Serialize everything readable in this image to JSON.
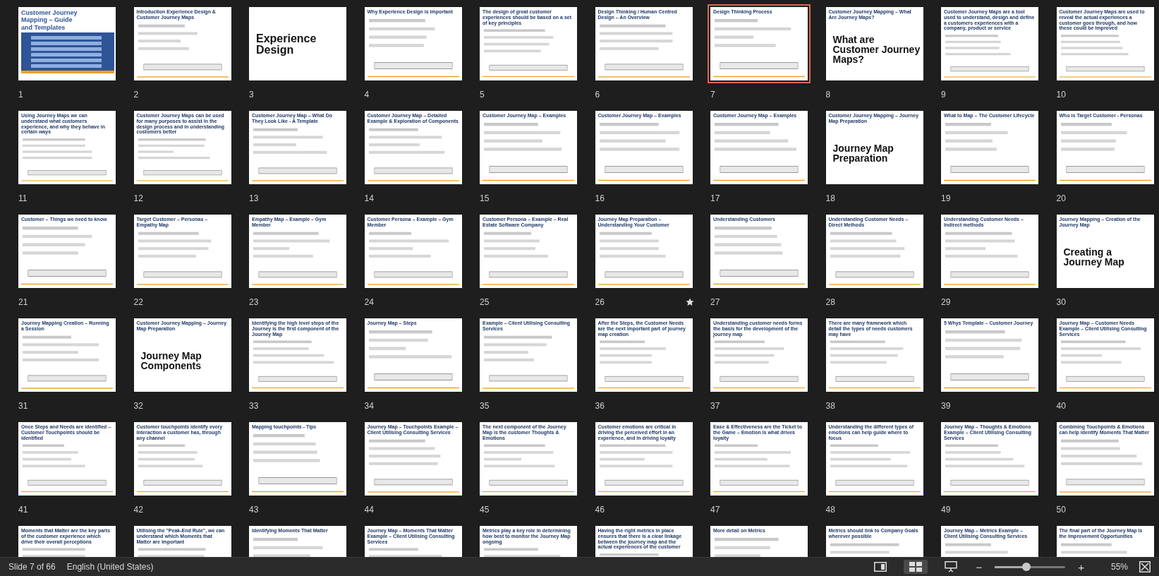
{
  "slides": [
    {
      "number": "1",
      "kind": "cover",
      "heading": "Customer Journey Mapping – Guide and Templates",
      "selected": false
    },
    {
      "number": "2",
      "kind": "content",
      "heading": "Introduction Experience Design & Customer Journey Maps",
      "selected": false
    },
    {
      "number": "3",
      "kind": "section",
      "big_text": "Experience Design",
      "selected": false
    },
    {
      "number": "4",
      "kind": "content",
      "heading": "Why Experience Design is Important",
      "selected": false
    },
    {
      "number": "5",
      "kind": "content",
      "heading": "The design of great customer experiences should be based on a set of key principles",
      "selected": false
    },
    {
      "number": "6",
      "kind": "content",
      "heading": "Design Thinking / Human Centred Design – An Overview",
      "selected": false
    },
    {
      "number": "7",
      "kind": "content",
      "heading": "Design Thinking Process",
      "selected": true
    },
    {
      "number": "8",
      "kind": "section",
      "heading": "Customer Journey Mapping – What Are Journey Maps?",
      "big_text": "What are Customer Journey Maps?",
      "selected": false
    },
    {
      "number": "9",
      "kind": "content",
      "heading": "Customer Journey Maps are a tool used to understand, design and define a customers experiences with a company, product or service",
      "selected": false
    },
    {
      "number": "10",
      "kind": "content",
      "heading": "Customer Journey Maps are used to reveal the actual experiences a customer goes through, and how these could be improved",
      "selected": false
    },
    {
      "number": "11",
      "kind": "content",
      "heading": "Using Journey Maps we can understand what customers experience, and why they behave in certain ways",
      "selected": false
    },
    {
      "number": "12",
      "kind": "content",
      "heading": "Customer Journey Maps can be used for many purposes to assist in the design process and in understanding customers better",
      "selected": false
    },
    {
      "number": "13",
      "kind": "content",
      "heading": "Customer Journey Map – What Do They Look Like - A Template",
      "selected": false
    },
    {
      "number": "14",
      "kind": "content",
      "heading": "Customer Journey Map – Detailed Example & Exploration of Components",
      "selected": false
    },
    {
      "number": "15",
      "kind": "content",
      "heading": "Customer Journey Map – Examples",
      "selected": false
    },
    {
      "number": "16",
      "kind": "content",
      "heading": "Customer Journey Map – Examples",
      "selected": false
    },
    {
      "number": "17",
      "kind": "content",
      "heading": "Customer Journey Map – Examples",
      "selected": false
    },
    {
      "number": "18",
      "kind": "section",
      "heading": "Customer Journey Mapping – Journey Map Preparation",
      "big_text": "Journey Map Preparation",
      "selected": false
    },
    {
      "number": "19",
      "kind": "content",
      "heading": "What to Map – The Customer Lifecycle",
      "selected": false
    },
    {
      "number": "20",
      "kind": "content",
      "heading": "Who is Target Customer - Personas",
      "selected": false
    },
    {
      "number": "21",
      "kind": "content",
      "heading": "Customer – Things we need to know",
      "selected": false
    },
    {
      "number": "22",
      "kind": "content",
      "heading": "Target Customer – Personas – Empathy Map",
      "selected": false
    },
    {
      "number": "23",
      "kind": "content",
      "heading": "Empathy Map – Example – Gym Member",
      "selected": false
    },
    {
      "number": "24",
      "kind": "content",
      "heading": "Customer Persona – Example – Gym Member",
      "selected": false
    },
    {
      "number": "25",
      "kind": "content",
      "heading": "Customer Persona – Example – Real Estate Software Company",
      "selected": false
    },
    {
      "number": "26",
      "kind": "content",
      "heading": "Journey Map Preparation – Understanding Your Customer",
      "selected": false,
      "animated": true
    },
    {
      "number": "27",
      "kind": "content",
      "heading": "Understanding Customers",
      "selected": false
    },
    {
      "number": "28",
      "kind": "content",
      "heading": "Understanding Customer Needs – Direct Methods",
      "selected": false
    },
    {
      "number": "29",
      "kind": "content",
      "heading": "Understanding Customer Needs – Indirect methods",
      "selected": false
    },
    {
      "number": "30",
      "kind": "section",
      "heading": "Journey Mapping – Creation of the Journey Map",
      "big_text": "Creating a Journey Map",
      "selected": false
    },
    {
      "number": "31",
      "kind": "content",
      "heading": "Journey Mapping Creation – Running a Session",
      "selected": false
    },
    {
      "number": "32",
      "kind": "section",
      "heading": "Customer Journey Mapping – Journey Map Preparation",
      "big_text": "Journey Map Components",
      "selected": false
    },
    {
      "number": "33",
      "kind": "content",
      "heading": "Identifying the high level steps of the Journey is the first component of the Journey Map",
      "selected": false
    },
    {
      "number": "34",
      "kind": "content",
      "heading": "Journey Map – Steps",
      "selected": false
    },
    {
      "number": "35",
      "kind": "content",
      "heading": "Example – Client Utilising Consulting Services",
      "selected": false
    },
    {
      "number": "36",
      "kind": "content",
      "heading": "After the Steps, the Customer Needs are the next important part of journey map creation",
      "selected": false
    },
    {
      "number": "37",
      "kind": "content",
      "heading": "Understanding customer needs forms the basis for the development of the journey map",
      "selected": false
    },
    {
      "number": "38",
      "kind": "content",
      "heading": "There are many framework which detail the types of needs customers may have",
      "selected": false
    },
    {
      "number": "39",
      "kind": "content",
      "heading": "5 Whys Template – Customer Journey",
      "selected": false
    },
    {
      "number": "40",
      "kind": "content",
      "heading": "Journey Map – Customer Needs Example – Client Utilising Consulting Services",
      "selected": false
    },
    {
      "number": "41",
      "kind": "content",
      "heading": "Once Steps and Needs are identified – Customer Touchpoints should be identified",
      "selected": false
    },
    {
      "number": "42",
      "kind": "content",
      "heading": "Customer touchpoints identify every interaction a customer has, through any channel",
      "selected": false
    },
    {
      "number": "43",
      "kind": "content",
      "heading": "Mapping touchpoints - Tips",
      "selected": false
    },
    {
      "number": "44",
      "kind": "content",
      "heading": "Journey Map – Touchpoints Example – Client Utilising Consulting Services",
      "selected": false
    },
    {
      "number": "45",
      "kind": "content",
      "heading": "The next component of the Journey Map is the customer Thoughts & Emotions",
      "selected": false
    },
    {
      "number": "46",
      "kind": "content",
      "heading": "Customer emotions are critical in driving the perceived effort in an experience, and in driving loyalty",
      "selected": false
    },
    {
      "number": "47",
      "kind": "content",
      "heading": "Ease & Effectiveness are the Ticket to the Game – Emotion is what drives loyalty",
      "selected": false
    },
    {
      "number": "48",
      "kind": "content",
      "heading": "Understanding the different types of emotions can help guide where to focus",
      "selected": false
    },
    {
      "number": "49",
      "kind": "content",
      "heading": "Journey Map – Thoughts & Emotions Example – Client Utilising Consulting Services",
      "selected": false
    },
    {
      "number": "50",
      "kind": "content",
      "heading": "Combining Touchpoints & Emotions can help identify Moments That Matter",
      "selected": false
    },
    {
      "kind": "content",
      "heading": "Moments that Matter are the key parts of the customer experience which drive their overall perceptions",
      "selected": false
    },
    {
      "kind": "content",
      "heading": "Utilising the \"Peak-End Rule\", we can understand which Moments that Matter are important",
      "selected": false
    },
    {
      "kind": "content",
      "heading": "Identifying Moments That Matter",
      "selected": false
    },
    {
      "kind": "content",
      "heading": "Journey Map – Moments That Matter Example – Client Utilising Consulting Services",
      "selected": false
    },
    {
      "kind": "content",
      "heading": "Metrics play a key role in determining how best to monitor the Journey Map ongoing",
      "selected": false
    },
    {
      "kind": "content",
      "heading": "Having the right metrics in place ensures that there is a clear linkage between the journey map and the actual experiences of the customer",
      "selected": false
    },
    {
      "kind": "content",
      "heading": "More detail on Metrics",
      "selected": false
    },
    {
      "kind": "content",
      "heading": "Metrics should link to Company Goals wherever possible",
      "selected": false
    },
    {
      "kind": "content",
      "heading": "Journey Map – Metrics Example – Client Utilising Consulting Services",
      "selected": false
    },
    {
      "kind": "content",
      "heading": "The final part of the Journey Map is the Improvement Opportunities",
      "selected": false
    }
  ],
  "status_bar": {
    "slide_position": "Slide 7 of 66",
    "language": "English (United States)",
    "views": [
      {
        "kind": "normal",
        "selected": false
      },
      {
        "kind": "sorter",
        "selected": true
      },
      {
        "kind": "presenter",
        "selected": false
      }
    ],
    "zoom": {
      "minus": "−",
      "plus": "+",
      "level": 0.45,
      "reading": "55%"
    }
  }
}
